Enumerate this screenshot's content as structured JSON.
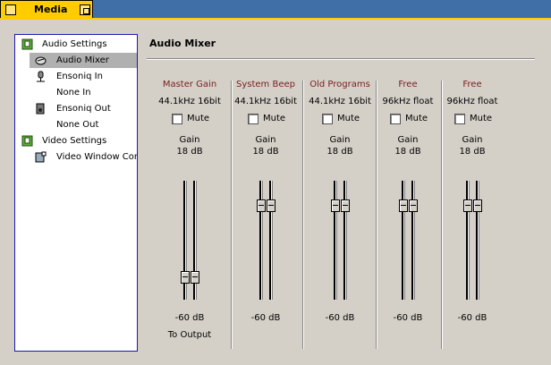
{
  "window": {
    "tab_title": "Media"
  },
  "sidebar": {
    "items": [
      {
        "label": "Audio Settings",
        "icon": "settings-icon",
        "selected": false
      },
      {
        "label": "Audio Mixer",
        "icon": "mixer-icon",
        "selected": true
      },
      {
        "label": "Ensoniq In",
        "icon": "microphone-icon",
        "selected": false
      },
      {
        "label": "None In",
        "icon": "",
        "selected": false
      },
      {
        "label": "Ensoniq Out",
        "icon": "speaker-icon",
        "selected": false
      },
      {
        "label": "None Out",
        "icon": "",
        "selected": false
      },
      {
        "label": "Video Settings",
        "icon": "settings-icon",
        "selected": false
      },
      {
        "label": "Video Window Con",
        "icon": "video-window-icon",
        "selected": false
      }
    ]
  },
  "panel": {
    "title": "Audio Mixer",
    "mute_label": "Mute",
    "gain_label": "Gain",
    "channels": [
      {
        "name": "Master Gain",
        "format": "44.1kHz 16bit",
        "gain": "18 dB",
        "min": "-60 dB",
        "output": "To Output",
        "muted": false,
        "level": 0.15
      },
      {
        "name": "System Beep",
        "format": "44.1kHz 16bit",
        "gain": "18 dB",
        "min": "-60 dB",
        "output": "",
        "muted": false,
        "level": 0.82
      },
      {
        "name": "Old Programs",
        "format": "44.1kHz 16bit",
        "gain": "18 dB",
        "min": "-60 dB",
        "output": "",
        "muted": false,
        "level": 0.82
      },
      {
        "name": "Free",
        "format": "96kHz float",
        "gain": "18 dB",
        "min": "-60 dB",
        "output": "",
        "muted": false,
        "level": 0.82
      },
      {
        "name": "Free",
        "format": "96kHz float",
        "gain": "18 dB",
        "min": "-60 dB",
        "output": "",
        "muted": false,
        "level": 0.82
      }
    ]
  },
  "colors": {
    "tab": "#ffcc00",
    "channel_name": "#7a2020",
    "background": "#d4d0c8",
    "sidebar_border": "#1a1ab0"
  }
}
